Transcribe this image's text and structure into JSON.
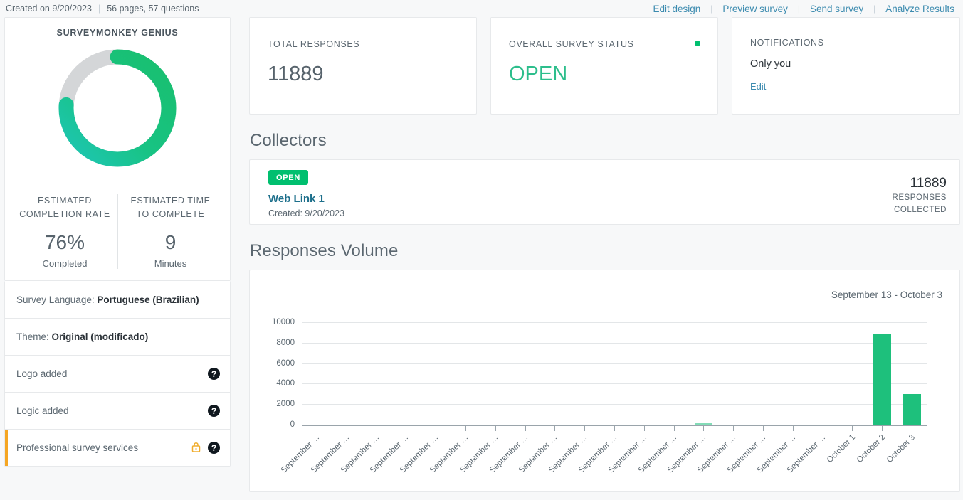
{
  "topbar": {
    "created_text": "Created on 9/20/2023",
    "separator": "|",
    "pages_questions": "56 pages, 57 questions",
    "links": [
      {
        "label": "Edit design"
      },
      {
        "label": "Preview survey"
      },
      {
        "label": "Send survey"
      },
      {
        "label": "Analyze Results"
      }
    ]
  },
  "sidebar": {
    "genius": {
      "title": "SURVEYMONKEY GENIUS",
      "donut_percent": 76,
      "donut_track_color": "#d4d6d8",
      "donut_color_start": "#1ec6b6",
      "donut_color_end": "#19bf6e",
      "stats": [
        {
          "label": "ESTIMATED COMPLETION RATE",
          "value": "76%",
          "sub": "Completed"
        },
        {
          "label": "ESTIMATED TIME TO COMPLETE",
          "value": "9",
          "sub": "Minutes"
        }
      ]
    },
    "items": [
      {
        "prefix": "Survey Language: ",
        "strong": "Portuguese (Brazilian)",
        "help": false,
        "lock": false,
        "flagged": false
      },
      {
        "prefix": "Theme: ",
        "strong": "Original (modificado)",
        "help": false,
        "lock": false,
        "flagged": false
      },
      {
        "prefix": "Logo added",
        "strong": "",
        "help": true,
        "lock": false,
        "flagged": false
      },
      {
        "prefix": "Logic added",
        "strong": "",
        "help": true,
        "lock": false,
        "flagged": false
      },
      {
        "prefix": "Professional survey services",
        "strong": "",
        "help": true,
        "lock": true,
        "flagged": true
      }
    ],
    "help_glyph": "?"
  },
  "main": {
    "cards": [
      {
        "label": "TOTAL RESPONSES",
        "value": "11889",
        "type": "number"
      },
      {
        "label": "OVERALL SURVEY STATUS",
        "value": "OPEN",
        "type": "status",
        "dot_color": "#00bf6f"
      },
      {
        "label": "NOTIFICATIONS",
        "value": "Only you",
        "link": "Edit",
        "type": "notifications"
      }
    ],
    "collectors": {
      "title": "Collectors",
      "badge": "OPEN",
      "name": "Web Link 1",
      "created": "Created: 9/20/2023",
      "count": "11889",
      "count_label_line1": "RESPONSES",
      "count_label_line2": "COLLECTED"
    },
    "responses_volume": {
      "title": "Responses Volume",
      "date_range": "September 13 - October 3"
    }
  },
  "chart_data": {
    "type": "bar",
    "title": "Responses Volume",
    "subtitle": "September 13 - October 3",
    "xlabel": "",
    "ylabel": "",
    "ylim": [
      0,
      10000
    ],
    "yticks": [
      0,
      2000,
      4000,
      6000,
      8000,
      10000
    ],
    "ytick_labels": [
      "0",
      "2000",
      "4000",
      "6000",
      "8000",
      "10000"
    ],
    "grid": true,
    "legend": false,
    "bar_color": "#1ec07c",
    "categories": [
      "September …",
      "September …",
      "September …",
      "September …",
      "September …",
      "September …",
      "September …",
      "September …",
      "September …",
      "September …",
      "September …",
      "September …",
      "September …",
      "September …",
      "September …",
      "September …",
      "September …",
      "September …",
      "October 1",
      "October 2",
      "October 3"
    ],
    "values": [
      0,
      0,
      0,
      0,
      0,
      0,
      0,
      0,
      0,
      0,
      0,
      0,
      0,
      30,
      0,
      0,
      0,
      0,
      0,
      8800,
      3000
    ]
  }
}
